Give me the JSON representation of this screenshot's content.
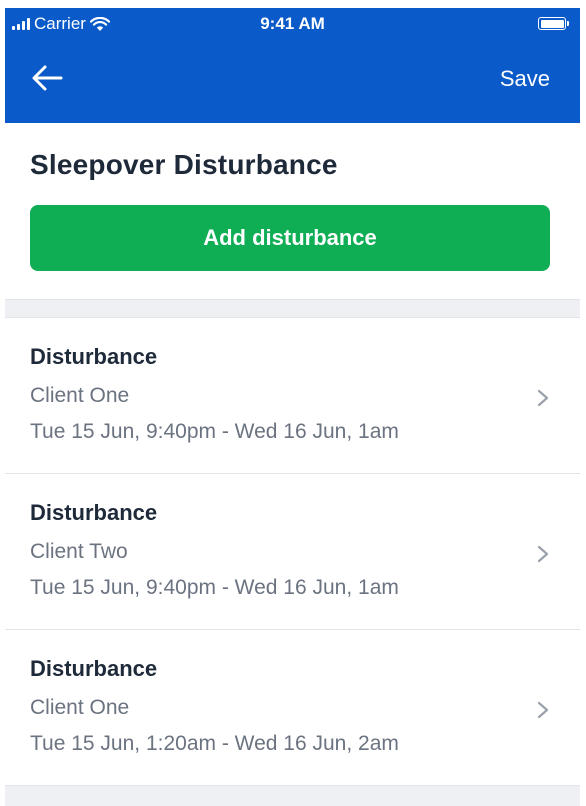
{
  "status_bar": {
    "carrier": "Carrier",
    "time": "9:41 AM"
  },
  "nav": {
    "save_label": "Save"
  },
  "header": {
    "title": "Sleepover Disturbance",
    "add_button_label": "Add disturbance"
  },
  "disturbances": [
    {
      "title": "Disturbance",
      "client": "Client One",
      "time_range": "Tue 15 Jun, 9:40pm - Wed 16 Jun, 1am"
    },
    {
      "title": "Disturbance",
      "client": "Client Two",
      "time_range": "Tue 15 Jun, 9:40pm - Wed 16 Jun, 1am"
    },
    {
      "title": "Disturbance",
      "client": "Client One",
      "time_range": "Tue 15 Jun, 1:20am - Wed 16 Jun, 2am"
    }
  ],
  "colors": {
    "nav_background": "#0a5bc9",
    "primary_button": "#0fae55",
    "title_text": "#1e2a3a",
    "secondary_text": "#6b7380"
  }
}
